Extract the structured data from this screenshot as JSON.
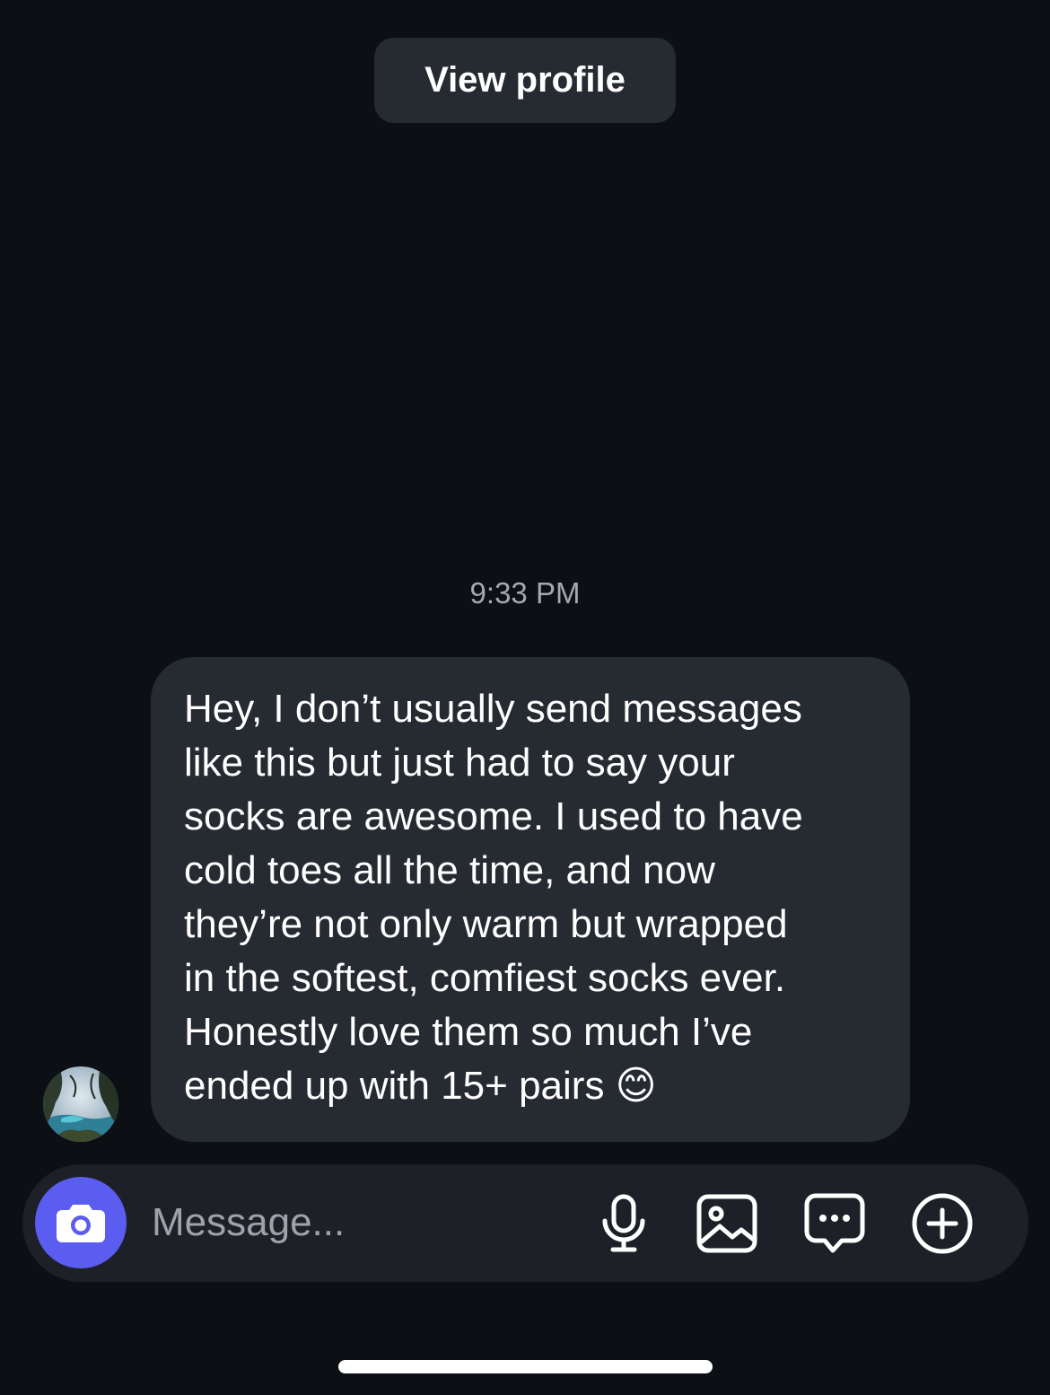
{
  "header": {
    "view_profile_label": "View profile"
  },
  "conversation": {
    "timestamp": "9:33 PM",
    "messages": [
      {
        "sender": "other",
        "text": "Hey, I don’t usually send messages\nlike this but just had to say your\nsocks are awesome. I used to have\ncold toes all the time, and now\nthey’re not only warm but wrapped\nin the softest, comfiest socks ever.\nHonestly love them so much I’ve\nended up with 15+ pairs 😊"
      }
    ]
  },
  "composer": {
    "placeholder": "Message...",
    "icons": [
      "camera-icon",
      "microphone-icon",
      "gallery-icon",
      "sticker-chat-icon",
      "plus-circle-icon"
    ]
  },
  "colors": {
    "background": "#0c0f14",
    "bubble": "#262a31",
    "composer": "#1d2026",
    "camera_accent": "#5b5cf0",
    "timestamp": "#a4a8b0"
  }
}
